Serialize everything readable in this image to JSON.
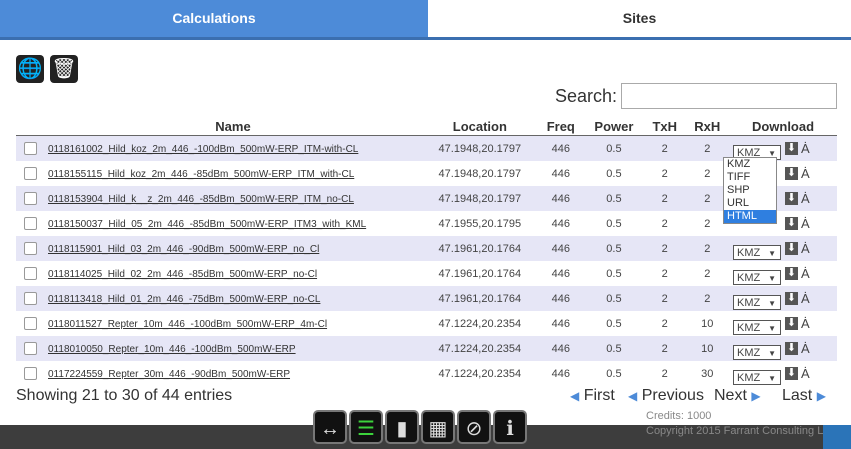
{
  "tabs": {
    "calculations": "Calculations",
    "sites": "Sites"
  },
  "toolbar": {
    "globe": "globe-icon",
    "trash": "trash-icon"
  },
  "search": {
    "label": "Search:",
    "value": ""
  },
  "table": {
    "headers": {
      "name": "Name",
      "location": "Location",
      "freq": "Freq",
      "power": "Power",
      "txh": "TxH",
      "rxh": "RxH",
      "download": "Download"
    },
    "rows": [
      {
        "name": "0118161002_Hild_koz_2m_446_-100dBm_500mW-ERP_ITM-with-CL",
        "location": "47.1948,20.1797",
        "freq": "446",
        "power": "0.5",
        "txh": "2",
        "rxh": "2",
        "format": "KMZ"
      },
      {
        "name": "0118155115_Hild_koz_2m_446_-85dBm_500mW-ERP_ITM_with-CL",
        "location": "47.1948,20.1797",
        "freq": "446",
        "power": "0.5",
        "txh": "2",
        "rxh": "2",
        "format": "KMZ"
      },
      {
        "name": "0118153904_Hild_k__z_2m_446_-85dBm_500mW-ERP_ITM_no-CL",
        "location": "47.1948,20.1797",
        "freq": "446",
        "power": "0.5",
        "txh": "2",
        "rxh": "2",
        "format": "KMZ"
      },
      {
        "name": "0118150037_Hild_05_2m_446_-85dBm_500mW-ERP_ITM3_with_KML",
        "location": "47.1955,20.1795",
        "freq": "446",
        "power": "0.5",
        "txh": "2",
        "rxh": "2",
        "format": "KMZ"
      },
      {
        "name": "0118115901_Hild_03_2m_446_-90dBm_500mW-ERP_no_Cl",
        "location": "47.1961,20.1764",
        "freq": "446",
        "power": "0.5",
        "txh": "2",
        "rxh": "2",
        "format": "KMZ"
      },
      {
        "name": "0118114025_Hild_02_2m_446_-85dBm_500mW-ERP_no-Cl",
        "location": "47.1961,20.1764",
        "freq": "446",
        "power": "0.5",
        "txh": "2",
        "rxh": "2",
        "format": "KMZ"
      },
      {
        "name": "0118113418_Hild_01_2m_446_-75dBm_500mW-ERP_no-CL",
        "location": "47.1961,20.1764",
        "freq": "446",
        "power": "0.5",
        "txh": "2",
        "rxh": "2",
        "format": "KMZ"
      },
      {
        "name": "0118011527_Repter_10m_446_-100dBm_500mW-ERP_4m-Cl",
        "location": "47.1224,20.2354",
        "freq": "446",
        "power": "0.5",
        "txh": "2",
        "rxh": "10",
        "format": "KMZ"
      },
      {
        "name": "0118010050_Repter_10m_446_-100dBm_500mW-ERP",
        "location": "47.1224,20.2354",
        "freq": "446",
        "power": "0.5",
        "txh": "2",
        "rxh": "10",
        "format": "KMZ"
      },
      {
        "name": "0117224559_Repter_30m_446_-90dBm_500mW-ERP",
        "location": "47.1224,20.2354",
        "freq": "446",
        "power": "0.5",
        "txh": "2",
        "rxh": "30",
        "format": "KMZ"
      }
    ]
  },
  "dropdown_options": [
    "KMZ",
    "TIFF",
    "SHP",
    "URL",
    "HTML"
  ],
  "dropdown_highlighted": "HTML",
  "pagination": {
    "info": "Showing 21 to 30 of 44 entries",
    "first": "First",
    "previous": "Previous",
    "next": "Next",
    "last": "Last"
  },
  "footer": {
    "credits": "Credits: 1000",
    "copyright": "Copyright 2015 Farrant Consulting Ltd"
  },
  "colors": {
    "accent": "#4d8bd8",
    "row_alt": "#e6e6f6",
    "footer": "#3d3d3d"
  }
}
